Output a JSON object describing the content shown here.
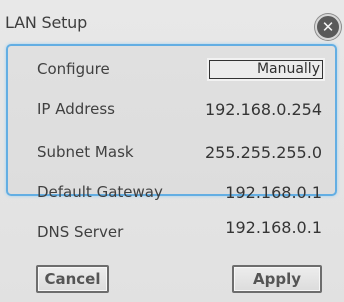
{
  "dialog": {
    "title": "LAN Setup",
    "close_icon": "close-icon"
  },
  "fields": {
    "configure": {
      "label": "Configure",
      "value": "Manually"
    },
    "ip_address": {
      "label": "IP Address",
      "value": "192.168.0.254"
    },
    "subnet_mask": {
      "label": "Subnet Mask",
      "value": "255.255.255.0"
    },
    "default_gateway": {
      "label": "Default Gateway",
      "value": "192.168.0.1"
    },
    "dns_server": {
      "label": "DNS Server",
      "value": "192.168.0.1"
    }
  },
  "buttons": {
    "cancel": "Cancel",
    "apply": "Apply"
  },
  "colors": {
    "highlight_border": "#63aee3",
    "background": "#e4e4e4"
  }
}
